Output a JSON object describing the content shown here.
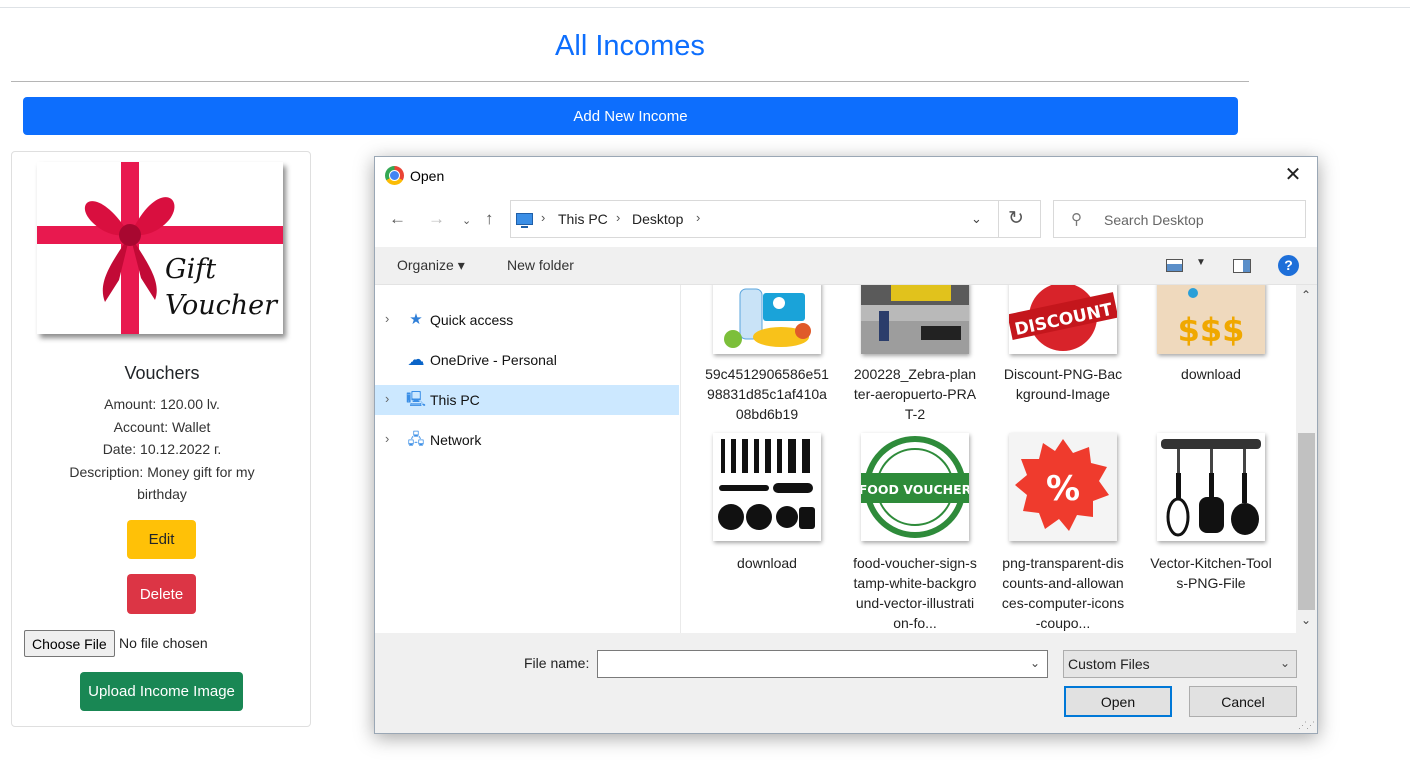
{
  "page": {
    "title": "All Incomes",
    "add_button": "Add New Income"
  },
  "card": {
    "image_text_line1": "Gift",
    "image_text_line2": "Voucher",
    "title": "Vouchers",
    "amount": "Amount: 120.00 lv.",
    "account": "Account: Wallet",
    "date": "Date: 10.12.2022 г.",
    "description": "Description: Money gift for my birthday",
    "edit_label": "Edit",
    "delete_label": "Delete",
    "choose_file_label": "Choose File",
    "no_file_text": "No file chosen",
    "upload_label": "Upload Income Image"
  },
  "dialog": {
    "title": "Open",
    "breadcrumb": [
      "This PC",
      "Desktop"
    ],
    "search_placeholder": "Search Desktop",
    "toolbar": {
      "organize": "Organize ▾",
      "new_folder": "New folder"
    },
    "nav_items": [
      {
        "label": "Quick access",
        "icon": "star-icon",
        "expandable": true,
        "selected": false
      },
      {
        "label": "OneDrive - Personal",
        "icon": "cloud-icon",
        "expandable": false,
        "selected": false
      },
      {
        "label": "This PC",
        "icon": "computer-icon",
        "expandable": true,
        "selected": true
      },
      {
        "label": "Network",
        "icon": "network-icon",
        "expandable": true,
        "selected": false
      }
    ],
    "files": [
      {
        "name": "59c4512906586e5198831d85c1af410a08bd6b19"
      },
      {
        "name": "200228_Zebra-planter-aeropuerto-PRAT-2"
      },
      {
        "name": "Discount-PNG-Background-Image",
        "thumb_text": "DISCOUNT"
      },
      {
        "name": "download",
        "thumb_text": "$$$"
      },
      {
        "name": "download"
      },
      {
        "name": "food-voucher-sign-stamp-white-background-vector-illustration-fo...",
        "thumb_text": "FOOD VOUCHER"
      },
      {
        "name": "png-transparent-discounts-and-allowances-computer-icons-coupo...",
        "thumb_text": "%"
      },
      {
        "name": "Vector-Kitchen-Tools-PNG-File"
      }
    ],
    "file_name_label": "File name:",
    "file_name_value": "",
    "file_type": "Custom Files",
    "open_label": "Open",
    "cancel_label": "Cancel"
  },
  "colors": {
    "primary": "#0d6efd",
    "warning": "#ffc107",
    "danger": "#dc3545",
    "success": "#198754",
    "selection": "#cce8ff"
  }
}
